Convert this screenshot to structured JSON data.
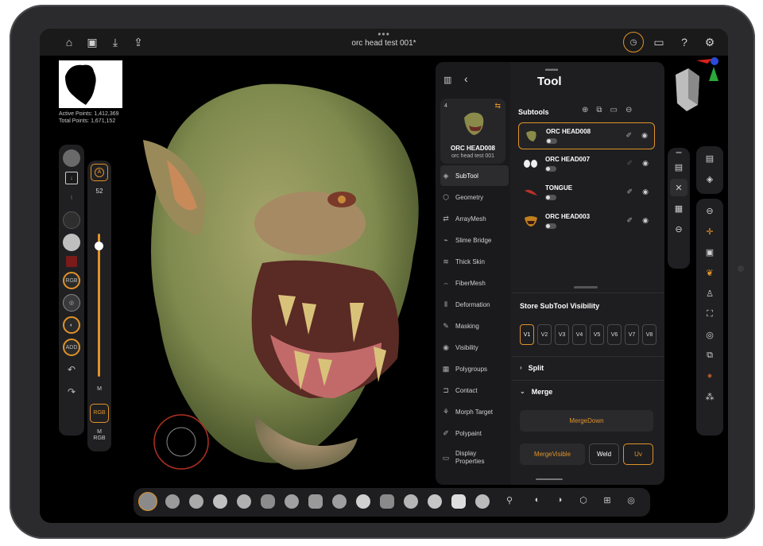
{
  "app": {
    "document_title": "orc head test 001*",
    "stats": {
      "active_points": "Active Points: 1,412,369",
      "total_points": "Total Points: 1,671,152"
    }
  },
  "left_sliders": {
    "size_value": "52",
    "mode_m": "M",
    "rgb": "RGB",
    "m_rgb_top": "M",
    "m_rgb_bottom": "RGB"
  },
  "tool_panel": {
    "title": "Tool",
    "card": {
      "count": "4",
      "name": "ORC HEAD008",
      "subtitle": "orc head test 001"
    },
    "menu": [
      {
        "label": "SubTool",
        "icon": "subtool-icon"
      },
      {
        "label": "Geometry",
        "icon": "geometry-icon"
      },
      {
        "label": "ArrayMesh",
        "icon": "arraymesh-icon"
      },
      {
        "label": "Slime Bridge",
        "icon": "slime-bridge-icon"
      },
      {
        "label": "Thick Skin",
        "icon": "thick-skin-icon"
      },
      {
        "label": "FiberMesh",
        "icon": "fibermesh-icon"
      },
      {
        "label": "Deformation",
        "icon": "deformation-icon"
      },
      {
        "label": "Masking",
        "icon": "masking-icon"
      },
      {
        "label": "Visibility",
        "icon": "visibility-icon"
      },
      {
        "label": "Polygroups",
        "icon": "polygroups-icon"
      },
      {
        "label": "Contact",
        "icon": "contact-icon"
      },
      {
        "label": "Morph Target",
        "icon": "morph-target-icon"
      },
      {
        "label": "Polypaint",
        "icon": "polypaint-icon"
      },
      {
        "label": "Display Properties",
        "icon": "display-properties-icon"
      }
    ],
    "subtools_heading": "Subtools",
    "subtools": [
      {
        "name": "ORC HEAD008",
        "selected": true
      },
      {
        "name": "ORC HEAD007",
        "selected": false
      },
      {
        "name": "TONGUE",
        "selected": false
      },
      {
        "name": "ORC HEAD003",
        "selected": false
      }
    ],
    "visibility_heading": "Store SubTool Visibility",
    "visibility_slots": [
      "V1",
      "V2",
      "V3",
      "V4",
      "V5",
      "V6",
      "V7",
      "V8"
    ],
    "split_label": "Split",
    "merge_label": "Merge",
    "merge_down": "MergeDown",
    "merge_visible": "MergeVisible",
    "weld": "Weld",
    "uv": "Uv"
  },
  "colors": {
    "accent": "#e0922a",
    "panel": "#1e1e20",
    "background": "#000000"
  }
}
